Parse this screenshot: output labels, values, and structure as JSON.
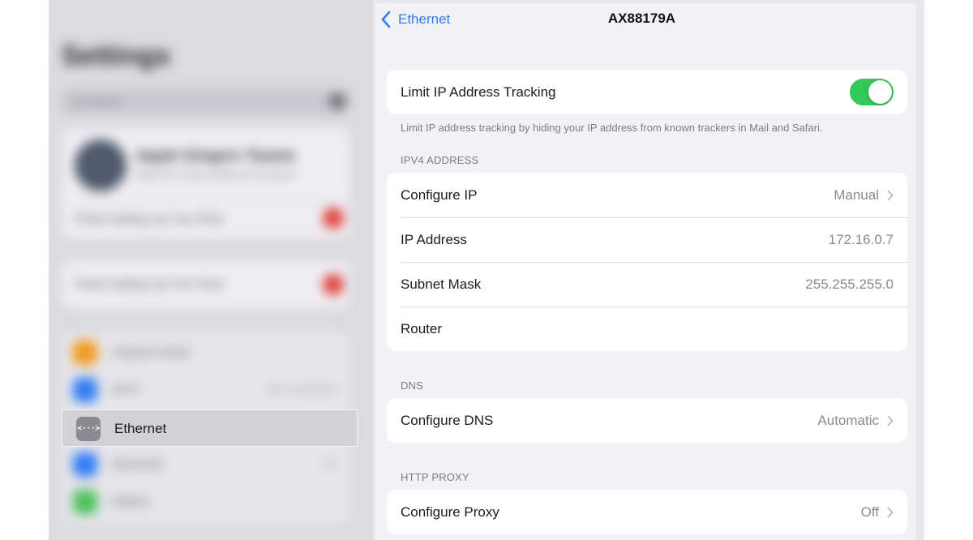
{
  "sidebar": {
    "title": "Settings",
    "search_placeholder": "Q Search",
    "account_name": "Apple Gingers Tauma",
    "account_sub": "Apple ID, iCloud, Media & Purchases",
    "row_setup": "Finish Setting Up Your iPad",
    "row_finish": "Finish Setting Up Your iPad",
    "list": [
      {
        "label": "Airplane Mode",
        "value": "",
        "color": "#f29a1f"
      },
      {
        "label": "Wi-Fi",
        "value": "Not Connected",
        "color": "#2f7cf6"
      },
      {
        "label": "Ethernet",
        "value": "",
        "color": "#8a8a90"
      },
      {
        "label": "Bluetooth",
        "value": "On",
        "color": "#2f7cf6"
      },
      {
        "label": "Battery",
        "value": "",
        "color": "#4cc05a"
      }
    ],
    "selected_label": "Ethernet",
    "selected_icon": "ethernet-icon"
  },
  "nav": {
    "back_label": "Ethernet",
    "title": "AX88179A"
  },
  "tracking": {
    "label": "Limit IP Address Tracking",
    "enabled": true,
    "footnote": "Limit IP address tracking by hiding your IP address from known trackers in Mail and Safari."
  },
  "ipv4": {
    "header": "IPV4 ADDRESS",
    "rows": [
      {
        "label": "Configure IP",
        "value": "Manual"
      },
      {
        "label": "IP Address",
        "value": "172.16.0.7"
      },
      {
        "label": "Subnet Mask",
        "value": "255.255.255.0"
      },
      {
        "label": "Router",
        "value": ""
      }
    ]
  },
  "dns": {
    "header": "DNS",
    "label": "Configure DNS",
    "value": "Automatic"
  },
  "proxy": {
    "header": "HTTP PROXY",
    "label": "Configure Proxy",
    "value": "Off"
  },
  "colors": {
    "accent": "#2f7cf6",
    "toggle_on": "#34c759",
    "badge": "#e0403a"
  }
}
